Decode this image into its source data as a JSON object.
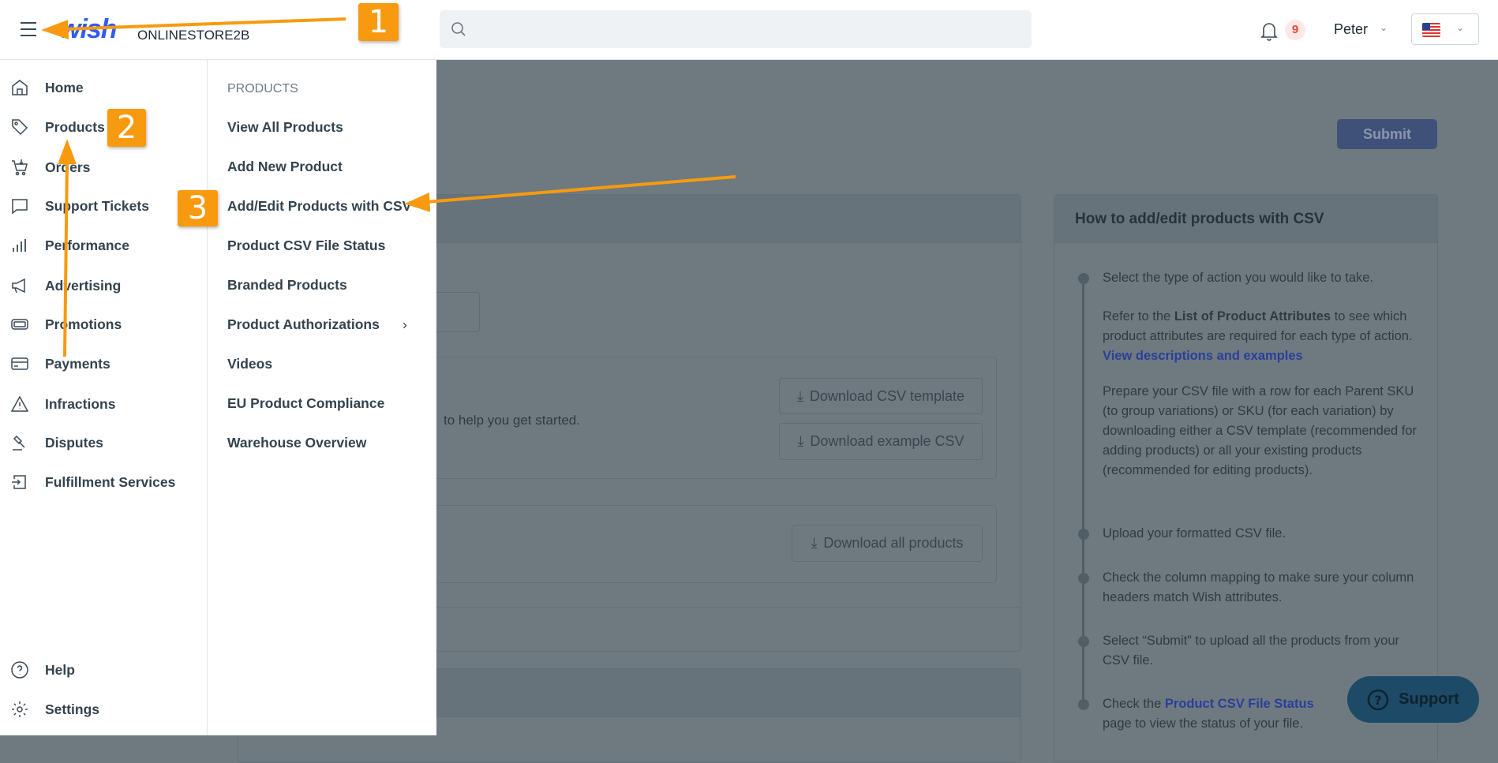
{
  "header": {
    "logo": "wish",
    "store_name": "ONLINESTORE2B",
    "search_placeholder": "",
    "notification_count": "9",
    "user_name": "Peter",
    "language": "US flag"
  },
  "sidebar": {
    "items": [
      {
        "label": "Home",
        "icon": "home-icon"
      },
      {
        "label": "Products",
        "icon": "tag-icon"
      },
      {
        "label": "Orders",
        "icon": "cart-icon"
      },
      {
        "label": "Support Tickets",
        "icon": "chat-icon"
      },
      {
        "label": "Performance",
        "icon": "bar-chart-icon"
      },
      {
        "label": "Advertising",
        "icon": "megaphone-icon"
      },
      {
        "label": "Promotions",
        "icon": "ticket-icon"
      },
      {
        "label": "Payments",
        "icon": "credit-card-icon"
      },
      {
        "label": "Infractions",
        "icon": "warning-icon"
      },
      {
        "label": "Disputes",
        "icon": "gavel-icon"
      },
      {
        "label": "Fulfillment Services",
        "icon": "box-arrow-icon"
      }
    ],
    "bottom_items": [
      {
        "label": "Help",
        "icon": "help-icon"
      },
      {
        "label": "Settings",
        "icon": "gear-icon"
      }
    ]
  },
  "submenu": {
    "heading": "PRODUCTS",
    "items": [
      "View All Products",
      "Add New Product",
      "Add/Edit Products with CSV",
      "Product CSV File Status",
      "Branded Products",
      "Product Authorizations",
      "Videos",
      "EU Product Compliance",
      "Warehouse Overview"
    ],
    "submenu_chevron": "›"
  },
  "main": {
    "submit_label": "Submit",
    "template_text": "to help you get started.",
    "download_template": "Download CSV template",
    "download_example": "Download example CSV",
    "download_all": "Download all products",
    "howto": {
      "title": "How to add/edit products with CSV",
      "step1": "Select the type of action you would like to take.",
      "step1_refer_a": "Refer to the ",
      "step1_refer_bold": "List of Product Attributes",
      "step1_refer_b": " to see which product attributes are required for each type of action. ",
      "step1_link": "View descriptions and examples",
      "step1_prepare": "Prepare your CSV file with a row for each Parent SKU (to group variations) or SKU (for each variation) by downloading either a CSV template (recommended for adding products) or all your existing products (recommended for editing products).",
      "step2": "Upload your formatted CSV file.",
      "step3": "Check the column mapping to make sure your column headers match Wish attributes.",
      "step4": "Select “Submit” to upload all the products from your CSV file.",
      "step5_a": "Check the ",
      "step5_link": "Product CSV File Status",
      "step5_b": " page to view the status of your file."
    },
    "support_label": "Support"
  },
  "annotations": [
    "1",
    "2",
    "3"
  ],
  "colors": {
    "brand": "#2f5cf0",
    "annotation": "#f89a0f",
    "badge": "#e5453a",
    "link": "#2b45c8"
  }
}
